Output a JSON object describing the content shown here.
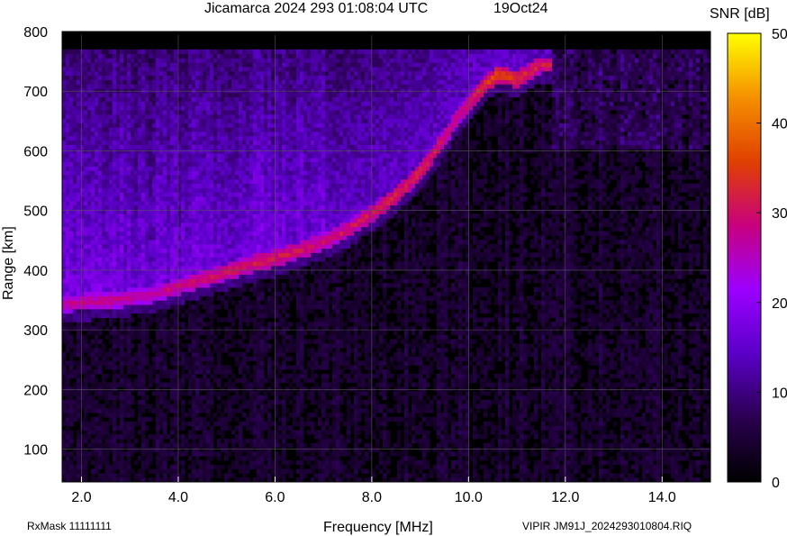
{
  "chart_data": {
    "type": "heatmap",
    "title": "Jicamarca 2024 293 01:08:04 UTC",
    "date_label": "19Oct24",
    "xlabel": "Frequency [MHz]",
    "ylabel": "Range [km]",
    "xlim": [
      1.6,
      15.0
    ],
    "ylim": [
      45,
      800
    ],
    "x_ticks": [
      2.0,
      4.0,
      6.0,
      8.0,
      10.0,
      12.0,
      14.0
    ],
    "x_tick_labels": [
      "2.0",
      "4.0",
      "6.0",
      "8.0",
      "10.0",
      "12.0",
      "14.0"
    ],
    "y_ticks": [
      100,
      200,
      300,
      400,
      500,
      600,
      700,
      800
    ],
    "y_tick_labels": [
      "100",
      "200",
      "300",
      "400",
      "500",
      "600",
      "700",
      "800"
    ],
    "grid": true,
    "colorbar": {
      "label": "SNR [dB]",
      "range": [
        0,
        50
      ],
      "ticks": [
        0,
        10,
        20,
        30,
        40,
        50
      ],
      "tick_labels": [
        "0",
        "10",
        "20",
        "30",
        "40",
        "50"
      ],
      "colors": [
        "#000000",
        "#2a0050",
        "#5a00c8",
        "#9b00ff",
        "#c8007f",
        "#e04000",
        "#f59000",
        "#ffff00"
      ]
    },
    "data_ceiling_km": 770,
    "echo_trace": {
      "frequency_mhz": [
        1.7,
        2.5,
        3.5,
        4.2,
        4.8,
        5.5,
        6.0,
        6.5,
        7.0,
        7.5,
        8.0,
        8.5,
        9.0,
        9.4,
        9.8,
        10.2,
        10.6,
        11.0,
        11.5
      ],
      "range_km": [
        345,
        348,
        360,
        378,
        392,
        410,
        420,
        433,
        448,
        468,
        495,
        525,
        565,
        610,
        660,
        700,
        730,
        720,
        745
      ],
      "snr_db": [
        26,
        27,
        26,
        28,
        29,
        30,
        30,
        29,
        28,
        29,
        30,
        31,
        31,
        30,
        27,
        32,
        34,
        32,
        30
      ]
    }
  },
  "footer": {
    "rxmask": "RxMask 11111111",
    "file_info": "VIPIR  JM91J_2024293010804.RIQ"
  }
}
